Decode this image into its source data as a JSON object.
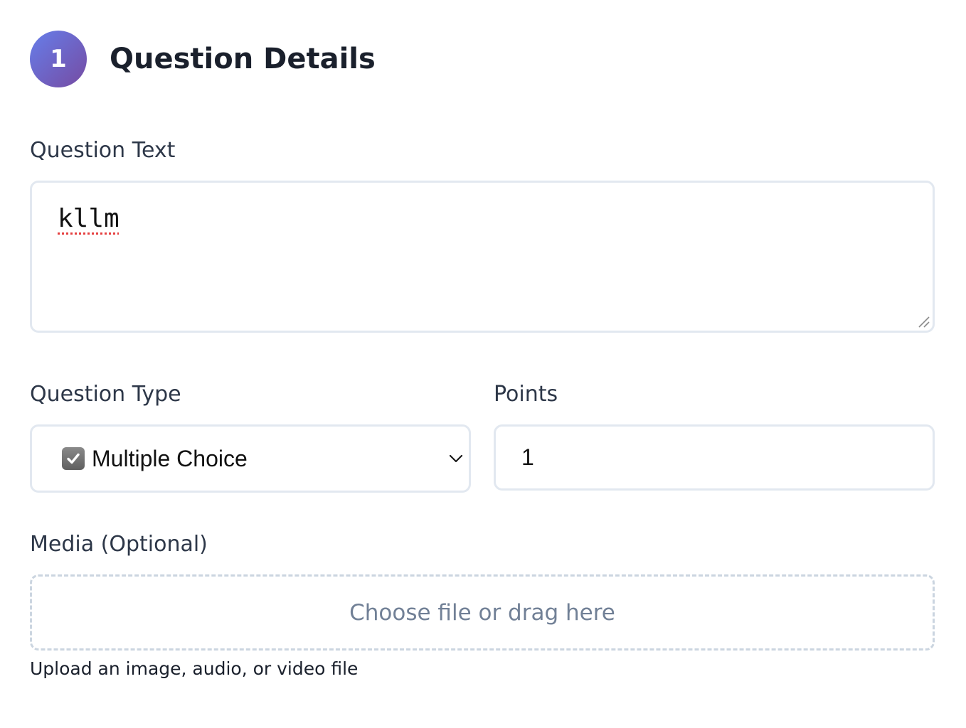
{
  "section": {
    "step_number": "1",
    "title": "Question Details"
  },
  "question_text": {
    "label": "Question Text",
    "value": "kllm"
  },
  "question_type": {
    "label": "Question Type",
    "selected": "Multiple Choice",
    "selected_icon": "checkbox-checked-icon"
  },
  "points": {
    "label": "Points",
    "value": "1"
  },
  "media": {
    "label": "Media (Optional)",
    "dropzone_text": "Choose file or drag here",
    "help_text": "Upload an image, audio, or video file"
  },
  "colors": {
    "badge_gradient_start": "#667eea",
    "badge_gradient_end": "#764ba2",
    "border": "#e2e8f0",
    "placeholder_text": "#718096"
  }
}
